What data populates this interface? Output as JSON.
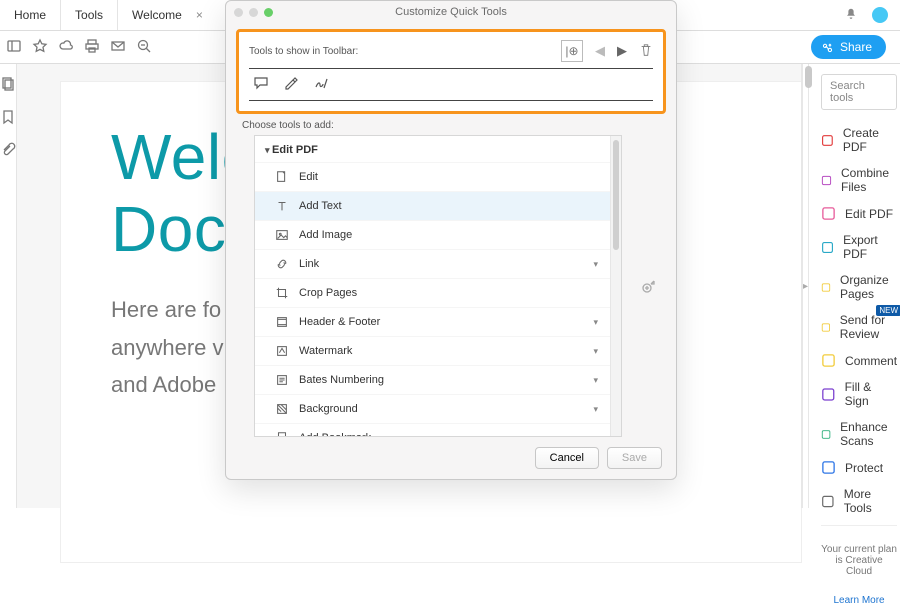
{
  "topbar": {
    "home": "Home",
    "tools": "Tools",
    "doc_tab": "Welcome",
    "close": "×"
  },
  "share_label": "Share",
  "page": {
    "title_l1": "Welc",
    "title_l2": "Docu",
    "body_l1": "Here are fo",
    "body_l2": "anywhere v",
    "body_l3": "and Adobe"
  },
  "rightpanel": {
    "search_placeholder": "Search tools",
    "tools": [
      {
        "label": "Create PDF",
        "c": "#e23a3a"
      },
      {
        "label": "Combine Files",
        "c": "#b74bc1"
      },
      {
        "label": "Edit PDF",
        "c": "#e75b9a"
      },
      {
        "label": "Export PDF",
        "c": "#2aa9c7"
      },
      {
        "label": "Organize Pages",
        "c": "#f2cc3c"
      },
      {
        "label": "Send for Review",
        "c": "#f2cc3c",
        "new": true
      },
      {
        "label": "Comment",
        "c": "#f2cc3c"
      },
      {
        "label": "Fill & Sign",
        "c": "#7b3fcf"
      },
      {
        "label": "Enhance Scans",
        "c": "#2fb07d"
      },
      {
        "label": "Protect",
        "c": "#2e76e6"
      },
      {
        "label": "More Tools",
        "c": "#6b6b6b"
      }
    ],
    "plan": "Your current plan is Creative Cloud",
    "learn": "Learn More"
  },
  "dialog": {
    "title": "Customize Quick Tools",
    "section1": "Tools to show in Toolbar:",
    "section2": "Choose tools to add:",
    "group": "Edit PDF",
    "items": [
      {
        "label": "Edit"
      },
      {
        "label": "Add Text",
        "sel": true
      },
      {
        "label": "Add Image"
      },
      {
        "label": "Link",
        "sub": true
      },
      {
        "label": "Crop Pages"
      },
      {
        "label": "Header & Footer",
        "sub": true
      },
      {
        "label": "Watermark",
        "sub": true
      },
      {
        "label": "Bates Numbering",
        "sub": true
      },
      {
        "label": "Background",
        "sub": true
      },
      {
        "label": "Add Bookmark"
      }
    ],
    "cancel": "Cancel",
    "save": "Save"
  }
}
